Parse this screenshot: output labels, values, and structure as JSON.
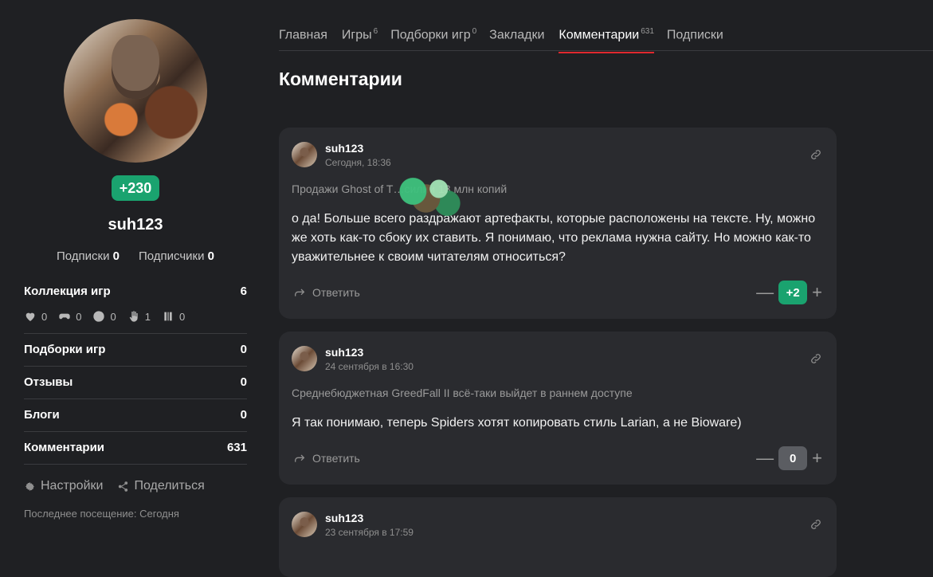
{
  "profile": {
    "rating": "+230",
    "username": "suh123",
    "subs_label": "Подписки",
    "subs_count": "0",
    "followers_label": "Подписчики",
    "followers_count": "0",
    "stats": [
      {
        "label": "Коллекция игр",
        "value": "6"
      },
      {
        "label": "Подборки игр",
        "value": "0"
      },
      {
        "label": "Отзывы",
        "value": "0"
      },
      {
        "label": "Блоги",
        "value": "0"
      },
      {
        "label": "Комментарии",
        "value": "631"
      }
    ],
    "collection_icons": [
      {
        "icon": "heart-icon",
        "value": "0"
      },
      {
        "icon": "gamepad-icon",
        "value": "0"
      },
      {
        "icon": "clock-icon",
        "value": "0"
      },
      {
        "icon": "hand-icon",
        "value": "1"
      },
      {
        "icon": "pause-icon",
        "value": "0"
      }
    ],
    "settings_label": "Настройки",
    "share_label": "Поделиться",
    "last_visit": "Последнее посещение: Сегодня",
    "rating_color": "#1aa36f"
  },
  "tabs": [
    {
      "label": "Главная",
      "count": ""
    },
    {
      "label": "Игры",
      "count": "6"
    },
    {
      "label": "Подборки игр",
      "count": "0"
    },
    {
      "label": "Закладки",
      "count": ""
    },
    {
      "label": "Комментарии",
      "count": "631"
    },
    {
      "label": "Подписки",
      "count": ""
    }
  ],
  "active_tab": "Комментарии",
  "page_title": "Комментарии",
  "comments": [
    {
      "user": "suh123",
      "date": "Сегодня, 18:36",
      "source": "Продажи Ghost of T…силии 13 млн копий",
      "text": "о да! Больше всего раздражают артефакты, которые расположены на тексте. Ну, можно же хоть как-то сбоку их ставить. Я понимаю, что реклама нужна сайту. Но можно как-то уважительнее к своим читателям относиться?",
      "reply_label": "Ответить",
      "votes": "+2"
    },
    {
      "user": "suh123",
      "date": "24 сентября в 16:30",
      "source": "Среднебюджетная GreedFall II всё-таки выйдет в раннем доступе",
      "text": "Я так понимаю, теперь Spiders хотят копировать стиль Larian, а не Bioware)",
      "reply_label": "Ответить",
      "votes": "0"
    },
    {
      "user": "suh123",
      "date": "23 сентября в 17:59"
    }
  ],
  "vote_minus": "—",
  "vote_plus": "+",
  "accent_color": "#e0282e"
}
